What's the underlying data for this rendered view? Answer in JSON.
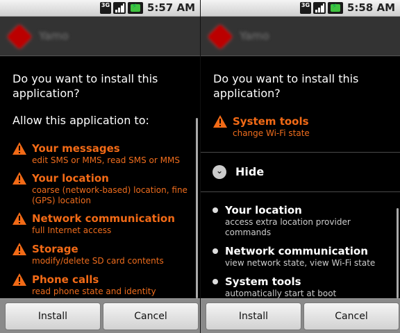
{
  "status_bar": {
    "network": "3G",
    "time_left": "5:57 AM",
    "time_right": "5:58 AM"
  },
  "app": {
    "name": "Yamo",
    "icon": "app-icon"
  },
  "question": "Do you want to install this application?",
  "left_screen": {
    "allow_header": "Allow this application to:",
    "permissions": [
      {
        "title": "Your messages",
        "desc": "edit SMS or MMS, read SMS or MMS"
      },
      {
        "title": "Your location",
        "desc": "coarse (network-based) location, fine (GPS) location"
      },
      {
        "title": "Network communication",
        "desc": "full Internet access"
      },
      {
        "title": "Storage",
        "desc": "modify/delete SD card contents"
      },
      {
        "title": "Phone calls",
        "desc": "read phone state and identity"
      }
    ]
  },
  "right_screen": {
    "warning": {
      "title": "System tools",
      "desc": "change Wi-Fi state"
    },
    "hide_label": "Hide",
    "hidden_permissions": [
      {
        "title": "Your location",
        "desc": "access extra location provider commands"
      },
      {
        "title": "Network communication",
        "desc": "view network state, view Wi-Fi state"
      },
      {
        "title": "System tools",
        "desc": "automatically start at boot"
      }
    ]
  },
  "buttons": {
    "install": "Install",
    "cancel": "Cancel"
  },
  "colors": {
    "warning": "#f26a16",
    "background": "#000000",
    "titlebar": "#333333"
  }
}
